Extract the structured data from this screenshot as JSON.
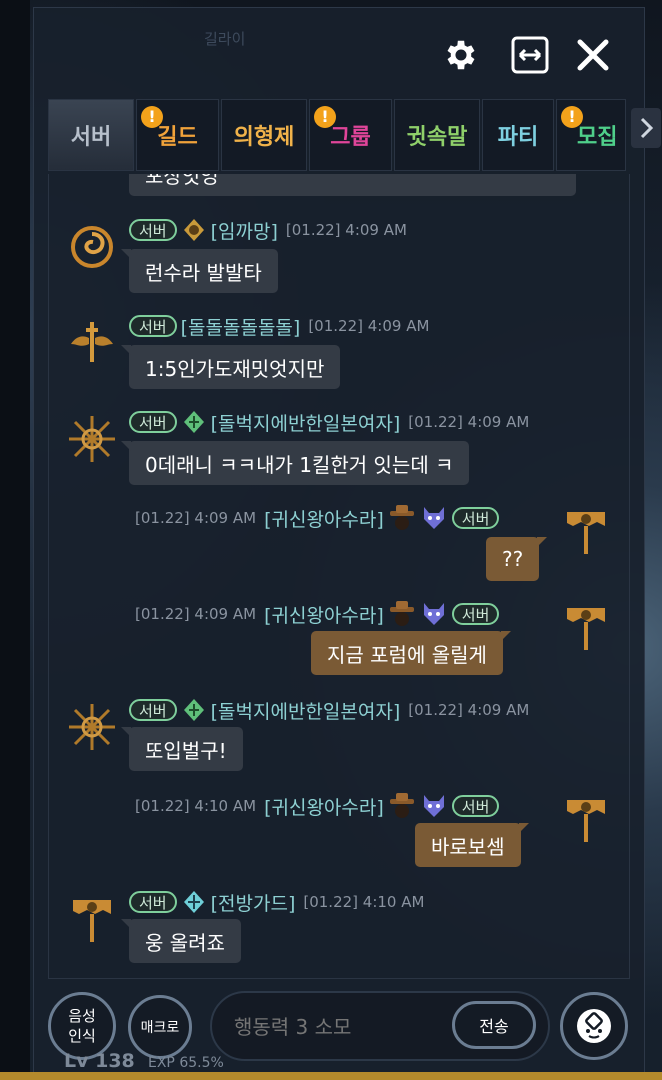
{
  "panel": {
    "faint_header": "길라이"
  },
  "top_buttons": {
    "settings": "gear-icon",
    "expand": "expand-icon",
    "close": "close-icon"
  },
  "tabs": [
    {
      "label": "서버",
      "color": "#b7c0cb",
      "active": true,
      "badge": ""
    },
    {
      "label": "길드",
      "color": "#f0a23a",
      "active": false,
      "badge": "!"
    },
    {
      "label": "의형제",
      "color": "#f0b24a",
      "active": false,
      "badge": ""
    },
    {
      "label": "그룹",
      "color": "#e0459a",
      "active": false,
      "badge": "!"
    },
    {
      "label": "귓속말",
      "color": "#8fd06a",
      "active": false,
      "badge": ""
    },
    {
      "label": "파티",
      "color": "#7ed0e0",
      "active": false,
      "badge": ""
    },
    {
      "label": "모집",
      "color": "#4fcf8a",
      "active": false,
      "badge": "!"
    }
  ],
  "messages": [
    {
      "partial_text": "포상잇엉"
    },
    {
      "side": "in",
      "channel": "서버",
      "name": "[임까망]",
      "time": "[01.22] 4:09 AM",
      "text": "런수라 발발타"
    },
    {
      "side": "in",
      "channel": "서버",
      "name": "[돌돌돌돌돌돌]",
      "time": "[01.22] 4:09 AM",
      "text": "1:5인가도재밋엇지만"
    },
    {
      "side": "in",
      "channel": "서버",
      "name": "[돌벅지에반한일본여자]",
      "time": "[01.22] 4:09 AM",
      "text": "0데래니 ㅋㅋ내가 1킬한거 잇는데 ㅋ"
    },
    {
      "side": "out",
      "channel": "서버",
      "name": "[귀신왕아수라]",
      "time": "[01.22] 4:09 AM",
      "text": "??"
    },
    {
      "side": "out",
      "channel": "서버",
      "name": "[귀신왕아수라]",
      "time": "[01.22] 4:09 AM",
      "text": "지금 포럼에 올릴게"
    },
    {
      "side": "in",
      "channel": "서버",
      "name": "[돌벅지에반한일본여자]",
      "time": "[01.22] 4:09 AM",
      "text": "또입벌구!"
    },
    {
      "side": "out",
      "channel": "서버",
      "name": "[귀신왕아수라]",
      "time": "[01.22] 4:10 AM",
      "text": "바로보셈"
    },
    {
      "side": "in",
      "channel": "서버",
      "name": "[전방가드]",
      "time": "[01.22] 4:10 AM",
      "text": "웅 올려죠"
    }
  ],
  "bottom": {
    "voice_label": "음성\n인식",
    "macro_label": "매크로",
    "input_placeholder": "행동력 3 소모",
    "send_label": "전송",
    "level": "Lv 138",
    "exp": "EXP 65.5%"
  }
}
